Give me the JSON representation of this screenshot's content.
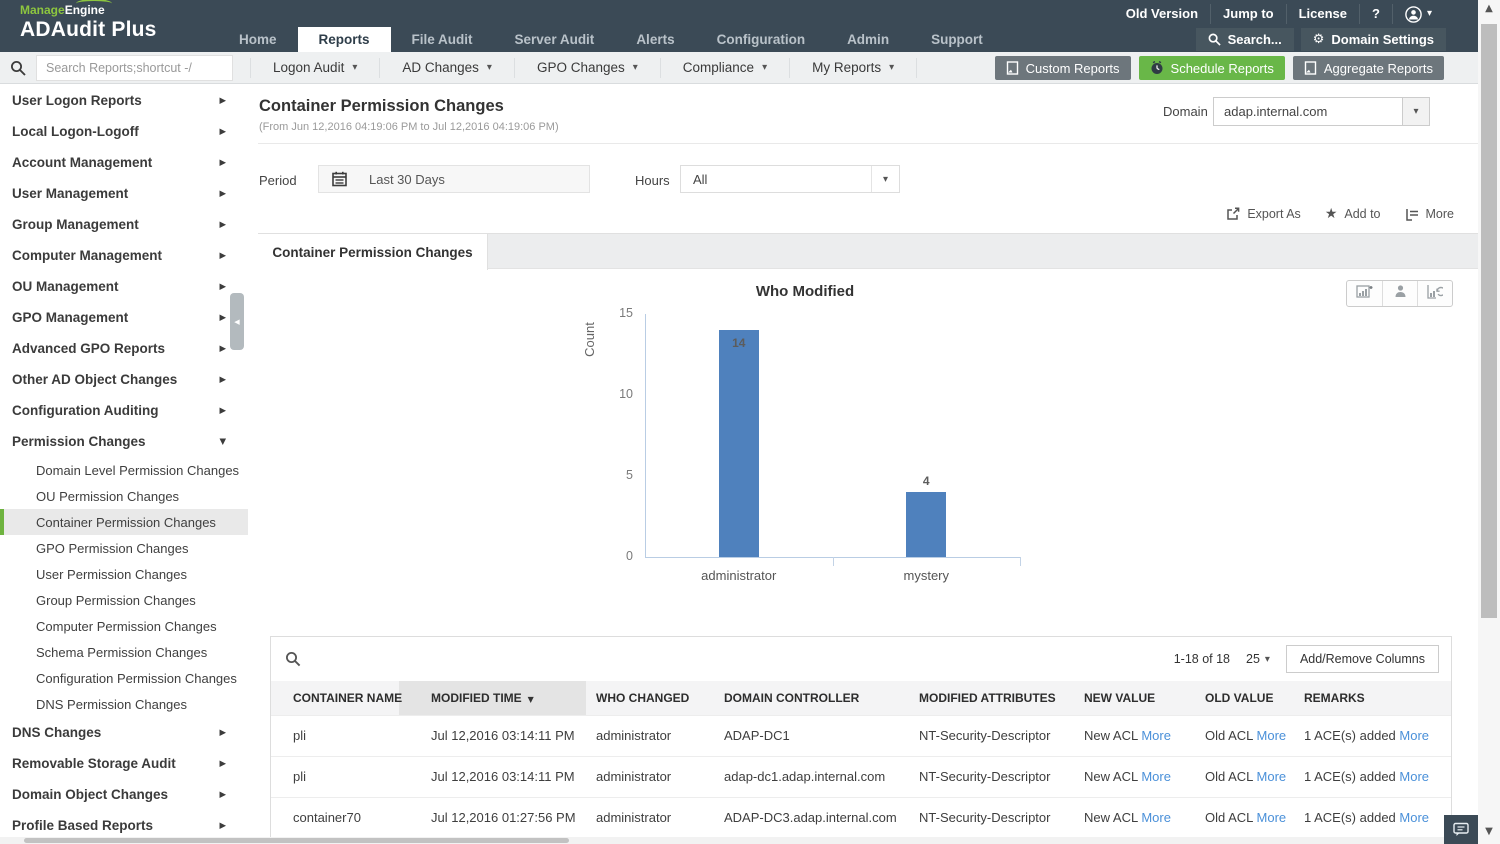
{
  "brand": {
    "company_part1": "Manage",
    "company_part2": "Engine",
    "product": "ADAudit Plus"
  },
  "header": {
    "nav": [
      {
        "label": "Home",
        "active": false
      },
      {
        "label": "Reports",
        "active": true
      },
      {
        "label": "File Audit",
        "active": false
      },
      {
        "label": "Server Audit",
        "active": false
      },
      {
        "label": "Alerts",
        "active": false
      },
      {
        "label": "Configuration",
        "active": false
      },
      {
        "label": "Admin",
        "active": false
      },
      {
        "label": "Support",
        "active": false
      }
    ],
    "utility": [
      "Old Version",
      "Jump to",
      "License"
    ],
    "help_label": "?",
    "search_label": "Search...",
    "domain_settings_label": "Domain Settings"
  },
  "toolbar": {
    "search_placeholder": "Search Reports;shortcut -/",
    "menus": [
      "Logon Audit",
      "AD Changes",
      "GPO Changes",
      "Compliance",
      "My Reports"
    ],
    "custom_reports_label": "Custom Reports",
    "schedule_reports_label": "Schedule Reports",
    "aggregate_reports_label": "Aggregate Reports"
  },
  "sidebar": {
    "items": [
      {
        "label": "User Logon Reports",
        "expanded": false
      },
      {
        "label": "Local Logon-Logoff",
        "expanded": false
      },
      {
        "label": "Account Management",
        "expanded": false
      },
      {
        "label": "User Management",
        "expanded": false
      },
      {
        "label": "Group Management",
        "expanded": false
      },
      {
        "label": "Computer Management",
        "expanded": false
      },
      {
        "label": "OU Management",
        "expanded": false
      },
      {
        "label": "GPO Management",
        "expanded": false
      },
      {
        "label": "Advanced GPO Reports",
        "expanded": false
      },
      {
        "label": "Other AD Object Changes",
        "expanded": false
      },
      {
        "label": "Configuration Auditing",
        "expanded": false
      },
      {
        "label": "Permission Changes",
        "expanded": true,
        "children": [
          {
            "label": "Domain Level Permission Changes",
            "selected": false
          },
          {
            "label": "OU Permission Changes",
            "selected": false
          },
          {
            "label": "Container Permission Changes",
            "selected": true
          },
          {
            "label": "GPO Permission Changes",
            "selected": false
          },
          {
            "label": "User Permission Changes",
            "selected": false
          },
          {
            "label": "Group Permission Changes",
            "selected": false
          },
          {
            "label": "Computer Permission Changes",
            "selected": false
          },
          {
            "label": "Schema Permission Changes",
            "selected": false
          },
          {
            "label": "Configuration Permission Changes",
            "selected": false
          },
          {
            "label": "DNS Permission Changes",
            "selected": false
          }
        ]
      },
      {
        "label": "DNS Changes",
        "expanded": false
      },
      {
        "label": "Removable Storage Audit",
        "expanded": false
      },
      {
        "label": "Domain Object Changes",
        "expanded": false
      },
      {
        "label": "Profile Based Reports",
        "expanded": false
      }
    ]
  },
  "report": {
    "title": "Container Permission Changes",
    "date_range": "(From Jun 12,2016 04:19:06 PM to Jul 12,2016 04:19:06 PM)",
    "domain_label": "Domain",
    "domain_value": "adap.internal.com",
    "period_label": "Period",
    "period_value": "Last 30 Days",
    "hours_label": "Hours",
    "hours_value": "All",
    "actions": {
      "export": "Export As",
      "add": "Add to",
      "more": "More"
    },
    "tab_label": "Container Permission Changes"
  },
  "chart_data": {
    "type": "bar",
    "title": "Who Modified",
    "ylabel": "Count",
    "xlabel": "",
    "categories": [
      "administrator",
      "mystery"
    ],
    "values": [
      14,
      4
    ],
    "ylim": [
      0,
      15
    ],
    "yticks": [
      0,
      5,
      10,
      15
    ],
    "bar_color": "#4f81bd",
    "grid": false,
    "legend": "none"
  },
  "table": {
    "pagination": "1-18 of 18",
    "page_size": "25",
    "add_remove_label": "Add/Remove Columns",
    "columns": [
      "CONTAINER NAME",
      "MODIFIED TIME",
      "WHO CHANGED",
      "DOMAIN CONTROLLER",
      "MODIFIED ATTRIBUTES",
      "NEW VALUE",
      "OLD VALUE",
      "REMARKS"
    ],
    "sort_column": "MODIFIED TIME",
    "sort_dir": "desc",
    "more_label": "More",
    "rows": [
      {
        "container": "pli",
        "time": "Jul 12,2016 03:14:11 PM",
        "who": "administrator",
        "dc": "ADAP-DC1",
        "attr": "NT-Security-Descriptor",
        "new_value": "New ACL",
        "old_value": "Old ACL",
        "remarks": "1 ACE(s) added"
      },
      {
        "container": "pli",
        "time": "Jul 12,2016 03:14:11 PM",
        "who": "administrator",
        "dc": "adap-dc1.adap.internal.com",
        "attr": "NT-Security-Descriptor",
        "new_value": "New ACL",
        "old_value": "Old ACL",
        "remarks": "1 ACE(s) added"
      },
      {
        "container": "container70",
        "time": "Jul 12,2016 01:27:56 PM",
        "who": "administrator",
        "dc": "ADAP-DC3.adap.internal.com",
        "attr": "NT-Security-Descriptor",
        "new_value": "New ACL",
        "old_value": "Old ACL",
        "remarks": "1 ACE(s) added"
      }
    ]
  },
  "colors": {
    "header_bg": "#3b4a56",
    "brand_green": "#8dc63f",
    "button_green": "#69b748",
    "button_gray": "#6d767c",
    "selected_green": "#6eb33f",
    "bar_blue": "#4f81bd",
    "link_blue": "#4a90d9"
  }
}
